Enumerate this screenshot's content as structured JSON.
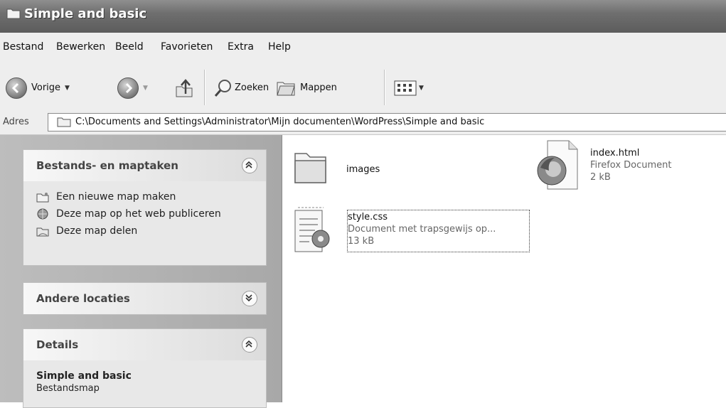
{
  "window": {
    "title": "Simple and basic"
  },
  "menu": {
    "items": [
      "Bestand",
      "Bewerken",
      "Beeld",
      "Favorieten",
      "Extra",
      "Help"
    ]
  },
  "toolbar": {
    "back_label": "Vorige",
    "search_label": "Zoeken",
    "folders_label": "Mappen"
  },
  "address": {
    "label": "Adres",
    "value": "C:\\Documents and Settings\\Administrator\\Mijn documenten\\WordPress\\Simple and basic"
  },
  "left_pane": {
    "tasks_panel": {
      "title": "Bestands- en maptaken",
      "items": [
        {
          "label": "Een nieuwe map maken",
          "icon": "new-folder-icon"
        },
        {
          "label": "Deze map op het web publiceren",
          "icon": "publish-web-icon"
        },
        {
          "label": "Deze map delen",
          "icon": "share-folder-icon"
        }
      ]
    },
    "other_panel": {
      "title": "Andere locaties"
    },
    "details_panel": {
      "title": "Details",
      "name": "Simple and basic",
      "type": "Bestandsmap"
    }
  },
  "files": [
    {
      "name": "images",
      "icon": "folder-icon"
    },
    {
      "name": "index.html",
      "type": "Firefox Document",
      "size": "2 kB",
      "icon": "firefox-document-icon"
    },
    {
      "name": "style.css",
      "type": "Document met trapsgewijs op...",
      "size": "13 kB",
      "icon": "css-document-icon"
    }
  ]
}
